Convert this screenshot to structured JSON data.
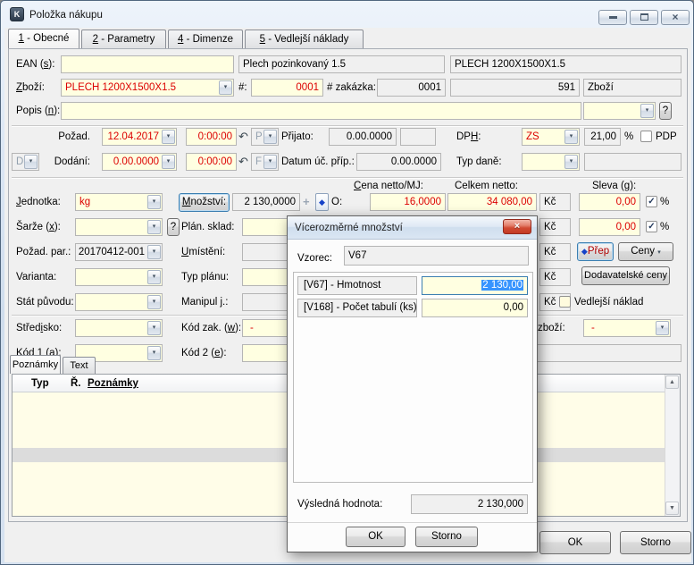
{
  "glyphs": {
    "dropdown": "▾",
    "undo": "↶",
    "plus": "+",
    "diamond": "◆",
    "check": "✓",
    "close": "×",
    "scroll_up": "▲",
    "scroll_down": "▼",
    "app": "K"
  },
  "window": {
    "title": "Položka nákupu"
  },
  "tabs": [
    {
      "text": "1 - Obecné",
      "u": 0
    },
    {
      "text": "2 - Parametry",
      "u": 0
    },
    {
      "text": "4 - Dimenze",
      "u": 0
    },
    {
      "text": "5 - Vedlejší náklady",
      "u": 0
    }
  ],
  "currency": "Kč",
  "head": {
    "ean_label": {
      "text": "EAN (s):",
      "u": 5
    },
    "ean_value": "",
    "name_short": "Plech pozinkovaný 1.5",
    "name_code": "PLECH 1200X1500X1.5",
    "zbozi_label": {
      "text": "Zboží:",
      "u": 0
    },
    "zbozi_value": "PLECH 1200X1500X1.5",
    "hash_label": "#:",
    "hash_value": "0001",
    "zakazka_label": "# zakázka:",
    "zakazka_value": "0001",
    "id_value": "591",
    "kind_value": "Zboží",
    "popis_label": {
      "text": "Popis (n):",
      "u": 7
    },
    "popis_value": "",
    "help": "?"
  },
  "dates": {
    "pozad_label": "Požad.",
    "pozad_date": "12.04.2017",
    "pozad_time": "0:00:00",
    "p_combo": "P",
    "prijato_label": "Přijato:",
    "prijato_value": "0.00.0000",
    "dph_label": {
      "text": "DPH:",
      "u": 2
    },
    "dph_value": "ZS",
    "dph_rate": "21,00",
    "percent": "%",
    "pdp_label": "PDP",
    "d_combo": "D",
    "dodani_label": "Dodání:",
    "dodani_date": "0.00.0000",
    "dodani_time": "0:00:00",
    "f_combo": "F",
    "datum_label": "Datum úč. příp.:",
    "datum_value": "0.00.0000",
    "typ_dane_label": "Typ daně:"
  },
  "qty": {
    "cena_label": {
      "text": "Cena netto/MJ:",
      "u": 0
    },
    "celkem_label": "Celkem netto:",
    "sleva_label": {
      "text": "Sleva (g):",
      "u": 7
    },
    "jednotka_label": {
      "text": "Jednotka:",
      "u": 0
    },
    "jednotka_value": "kg",
    "mnozstvi_button": {
      "text": "Množství:",
      "u": 0
    },
    "mnozstvi_value": "2 130,0000",
    "o_label": "O:",
    "cena_value": "16,0000",
    "celkem_value": "34 080,00",
    "sleva_value": "0,00",
    "sleva2_value": "0,00",
    "percent": "%"
  },
  "detail": {
    "sarze_label": {
      "text": "Šarže (x):",
      "u": 7
    },
    "sarze_help": "?",
    "plan_sklad_label": "Plán. sklad:",
    "pozad_par_label": "Požad. par.:",
    "pozad_par_value": "20170412-001",
    "umisteni_label": {
      "text": "Umístění:",
      "u": 0
    },
    "varianta_label": "Varianta:",
    "typ_planu_label": "Typ plánu:",
    "stat_label": "Stát původu:",
    "manipul_label": "Manipul j.:",
    "stredisko_label": {
      "text": "Středisko:",
      "u": 5
    },
    "kod_zak_label": {
      "text": "Kód zak. (w):",
      "u": 10
    },
    "kod_zak_value": "-",
    "kod1_label": {
      "text": "Kód 1 (a):",
      "u": 7
    },
    "kod2_label": {
      "text": "Kód 2 (e):",
      "u": 7
    },
    "prep_button": "Přep",
    "ceny_button": "Ceny",
    "dodavatelske_button": "Dodavatelské ceny",
    "vedlejsi_label": "Vedlejší náklad",
    "zbozi_label": "zboží:",
    "zbozi_value": "-"
  },
  "notes": {
    "tab_poznamky": "Poznámky",
    "tab_text": "Text",
    "col_typ": "Typ",
    "col_r": "Ř.",
    "col_poznamky": "Poznámky"
  },
  "footer": {
    "ok": "OK",
    "storno": "Storno"
  },
  "modal": {
    "title": "Vícerozměrné množství",
    "vzorec_label": "Vzorec:",
    "vzorec_value": "V67",
    "rows": [
      {
        "label": "[V67] - Hmotnost",
        "value": "2 130,00"
      },
      {
        "label": "[V168] - Počet tabulí (ks)",
        "value": "0,00"
      }
    ],
    "result_label": "Výsledná hodnota:",
    "result_value": "2 130,000",
    "ok": "OK",
    "storno": "Storno"
  }
}
